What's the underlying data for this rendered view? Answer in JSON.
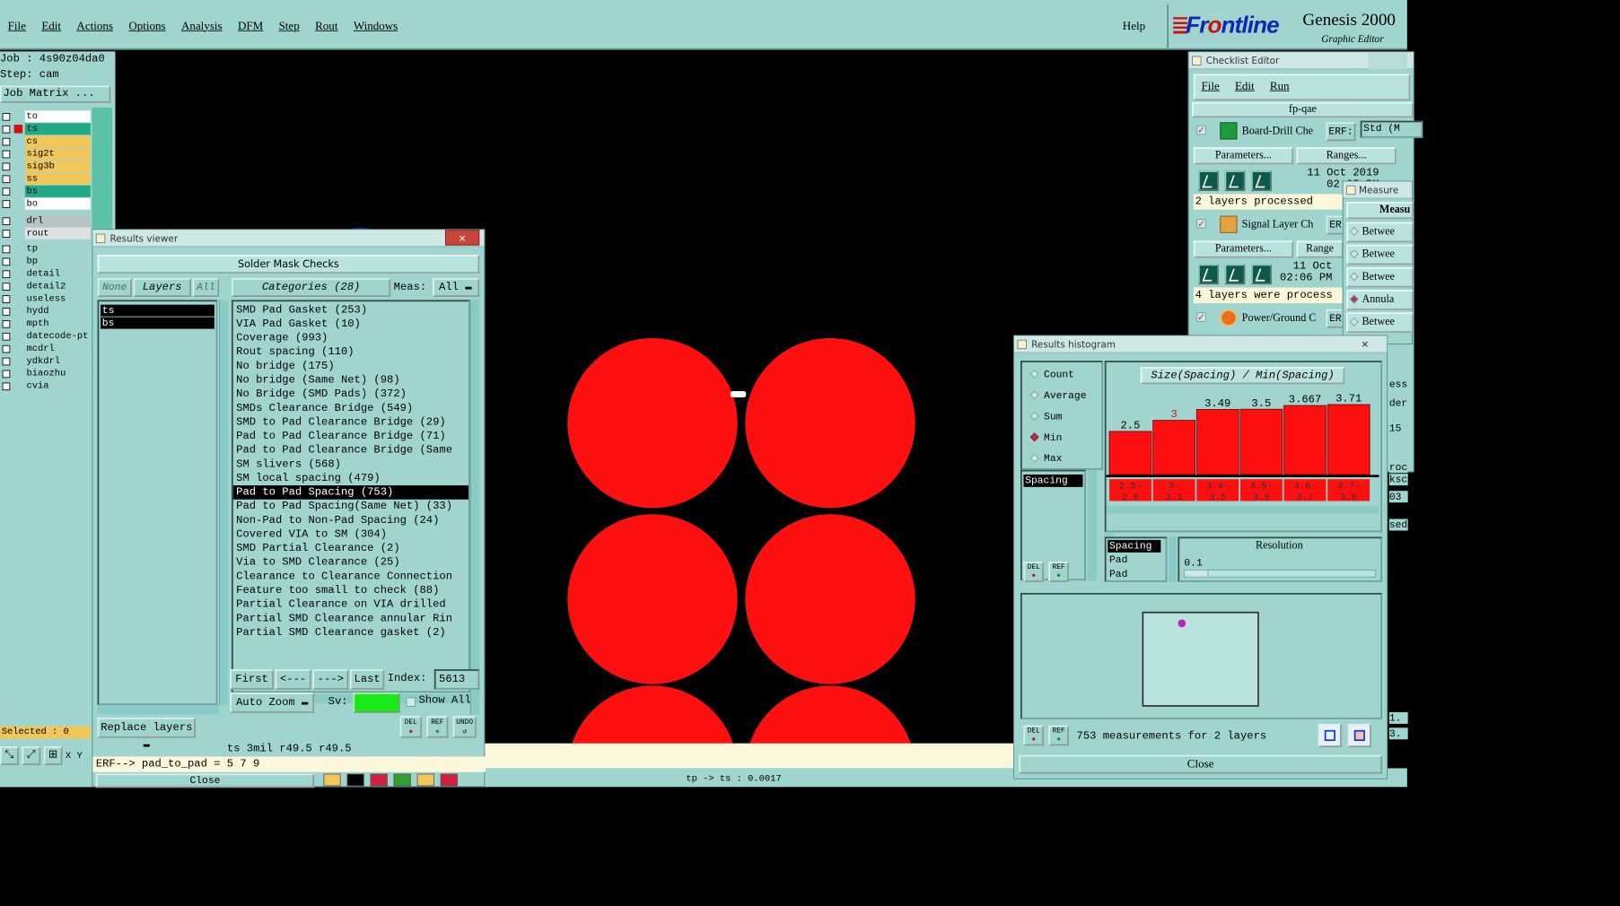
{
  "menubar": {
    "items": [
      "File",
      "Edit",
      "Actions",
      "Options",
      "Analysis",
      "DFM",
      "Step",
      "Rout",
      "Windows"
    ],
    "help": "Help"
  },
  "logo": {
    "brand_prefix": "Fr",
    "brand_suffix": "ntline",
    "brand_o": "o",
    "product": "Genesis 2000",
    "subtitle": "Graphic Editor"
  },
  "left": {
    "job": "Job : 4s90z04da0",
    "step": "Step: cam",
    "job_matrix": "Job Matrix ...",
    "layers": [
      {
        "name": "to",
        "color": "#ffffff"
      },
      {
        "name": "ts",
        "color": "#20a888",
        "active": true
      },
      {
        "name": "cs",
        "color": "#f1c75a"
      },
      {
        "name": "sig2t",
        "color": "#f1c75a"
      },
      {
        "name": "sig3b",
        "color": "#f1c75a"
      },
      {
        "name": "ss",
        "color": "#f1c75a"
      },
      {
        "name": "bs",
        "color": "#20a888"
      },
      {
        "name": "bo",
        "color": "#ffffff"
      }
    ],
    "drill_layers": [
      {
        "name": "drl",
        "color": "#b8c4c4"
      },
      {
        "name": "rout",
        "color": "#e0e0e0"
      }
    ],
    "misc_layers": [
      "tp",
      "bp",
      "detail",
      "detail2",
      "useless",
      "hydd",
      "mpth",
      "datecode-pt",
      "mcdrl",
      "ydkdrl",
      "biaozhu",
      "cvia"
    ],
    "selected": "Selected : 0",
    "xy": "X Y"
  },
  "results_viewer": {
    "title": "Results viewer",
    "heading": "Solder Mask Checks",
    "none": "None",
    "layers": "Layers",
    "all": "All",
    "layer_items": [
      "ts",
      "bs"
    ],
    "categories_label": "Categories (28)",
    "meas_label": "Meas:",
    "meas_value": "All",
    "categories": [
      "SMD Pad Gasket (253)",
      "VIA Pad Gasket (10)",
      "Coverage (993)",
      "Rout spacing (110)",
      "No bridge (175)",
      "No bridge (Same Net) (98)",
      "No Bridge (SMD Pads) (372)",
      "SMDs Clearance Bridge (549)",
      "SMD to Pad Clearance Bridge (29)",
      "Pad to Pad Clearance Bridge (71)",
      "Pad to Pad Clearance Bridge (Same",
      "SM slivers (568)",
      "SM local spacing (479)",
      "Pad to Pad Spacing (753)",
      "Pad to Pad Spacing(Same Net) (33)",
      "Non-Pad to Non-Pad Spacing (24)",
      "Covered VIA to SM (304)",
      "SMD Partial Clearance (2)",
      "Via to SMD Clearance (25)",
      "Clearance to Clearance Connection",
      "Feature too small to check (88)",
      "Partial Clearance on VIA drilled",
      "Partial SMD Clearance annular Rin",
      "Partial SMD Clearance gasket (2)"
    ],
    "selected_index": 13,
    "first": "First",
    "prev": "<---",
    "next": "--->",
    "last": "Last",
    "index_label": "Index:",
    "index_value": "5613",
    "auto_zoom": "Auto Zoom",
    "sv_label": "Sv:",
    "show_all": "Show All",
    "replace_layers": "Replace layers",
    "del": "DEL",
    "ref": "REF",
    "undo": "UNDO",
    "info": "ts 3mil  r49.5  r49.5",
    "erf": "ERF--> pad_to_pad = 5 7 9",
    "close": "Close"
  },
  "histogram": {
    "title": "Results histogram",
    "modes": [
      {
        "label": "Count",
        "on": false
      },
      {
        "label": "Average",
        "on": false
      },
      {
        "label": "Sum",
        "on": false
      },
      {
        "label": "Min",
        "on": true
      },
      {
        "label": "Max",
        "on": false
      }
    ],
    "list_item": "Spacing",
    "chart_title": "Size(Spacing) / Min(Spacing)",
    "bars": [
      {
        "label": "2.5",
        "bin": "2.5-\n2.6",
        "value": 2.5,
        "highlight": false
      },
      {
        "label": "3",
        "bin": "3-\n3.1",
        "value": 3,
        "highlight": true
      },
      {
        "label": "3.49",
        "bin": "3.4-\n3.5",
        "value": 3.49,
        "highlight": false
      },
      {
        "label": "3.5",
        "bin": "3.5-\n3.6",
        "value": 3.5,
        "highlight": false
      },
      {
        "label": "3.667",
        "bin": "3.6-\n3.7",
        "value": 3.667,
        "highlight": false
      },
      {
        "label": "3.71",
        "bin": "3.7-\n3.8",
        "value": 3.71,
        "highlight": false
      }
    ],
    "fields": [
      "Spacing",
      "Pad",
      "Pad"
    ],
    "resolution_label": "Resolution",
    "resolution_value": "0.1",
    "del": "DEL",
    "ref": "REF",
    "summary": "753 measurements for 2 layers",
    "close": "Close"
  },
  "checklist": {
    "title": "Checklist Editor",
    "menu": [
      "File",
      "Edit",
      "Run"
    ],
    "name": "fp-qae",
    "checks": [
      {
        "name": "Board-Drill Che",
        "erf": "ERF:",
        "std": "Std (M",
        "params": "Parameters...",
        "ranges": "Ranges...",
        "date": "11 Oct 2019",
        "time": "02:05 PM",
        "status": "2 layers processed"
      },
      {
        "name": "Signal Layer Ch",
        "erf": "ER",
        "params": "Parameters...",
        "ranges": "Range",
        "date": "11 Oct",
        "time": "02:06 PM",
        "status": "4 layers were process"
      },
      {
        "name": "Power/Ground C",
        "erf": "ER"
      }
    ]
  },
  "measure": {
    "title": "Measure",
    "head": "Measu",
    "items": [
      {
        "label": "Betwee",
        "on": false
      },
      {
        "label": "Betwee",
        "on": false
      },
      {
        "label": "Betwee",
        "on": false
      },
      {
        "label": "Annula",
        "on": true
      },
      {
        "label": "Betwee",
        "on": false
      }
    ]
  },
  "right_edge": [
    "ess",
    "der",
    "15",
    "roc",
    "ksc",
    "03",
    "sed",
    "1.",
    "3."
  ],
  "status": {
    "bottom": "tp -> ts : 0.0017"
  }
}
